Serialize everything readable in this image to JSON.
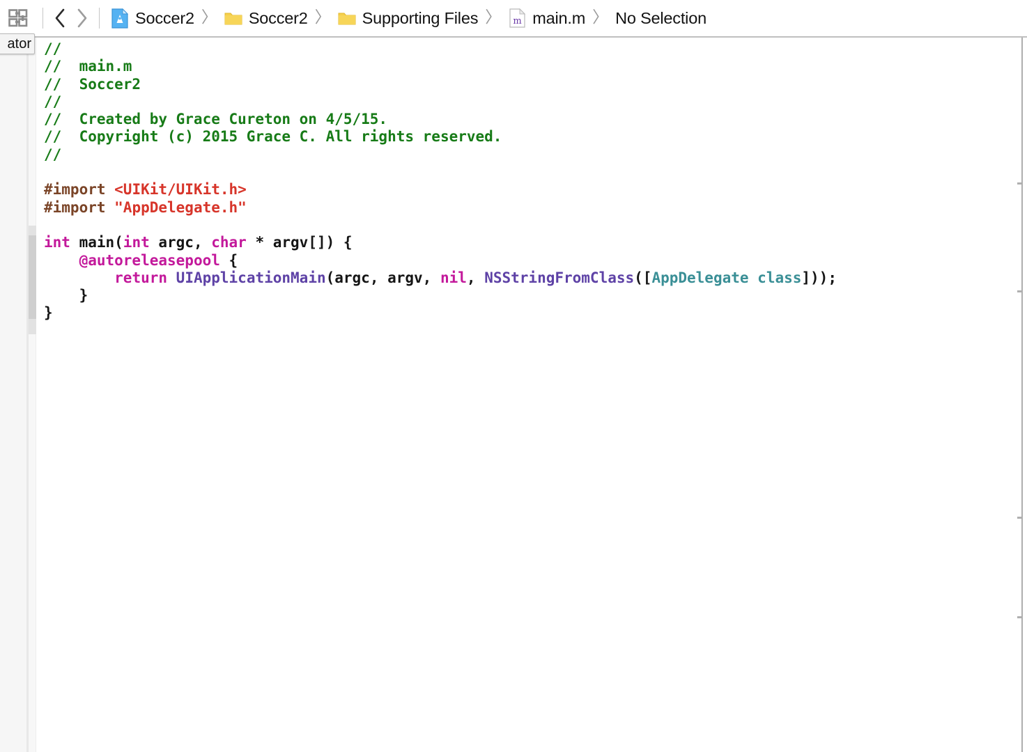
{
  "window": {
    "title": "main.m — Soccer2",
    "background": "#ffffff"
  },
  "jumpbar": {
    "navigator_toggle_icon": "navigator-grid-icon",
    "back_label": "‹",
    "forward_label": "›",
    "separator": "〉",
    "breadcrumbs": [
      {
        "label": "Soccer2",
        "icon": "xcode-project-icon"
      },
      {
        "label": "Soccer2",
        "icon": "folder-icon"
      },
      {
        "label": "Supporting Files",
        "icon": "folder-icon"
      },
      {
        "label": "main.m",
        "icon": "objc-file-icon"
      },
      {
        "label": "No Selection",
        "icon": "none"
      }
    ]
  },
  "tooltip": {
    "text": "ator"
  },
  "editor": {
    "file_name": "main.m",
    "language": "Objective-C",
    "colors": {
      "comment": "#177b17",
      "preprocessor": "#7a4427",
      "string": "#d7352a",
      "keyword": "#c3199b",
      "plain": "#151515",
      "function": "#5e42a6",
      "type": "#3a8f96",
      "background": "#ffffff",
      "gutter": "#f7f7f7"
    },
    "lines": [
      [
        {
          "t": "//",
          "c": "comment"
        }
      ],
      [
        {
          "t": "//  main.m",
          "c": "comment"
        }
      ],
      [
        {
          "t": "//  Soccer2",
          "c": "comment"
        }
      ],
      [
        {
          "t": "//",
          "c": "comment"
        }
      ],
      [
        {
          "t": "//  Created by Grace Cureton on 4/5/15.",
          "c": "comment"
        }
      ],
      [
        {
          "t": "//  Copyright (c) 2015 Grace C. All rights reserved.",
          "c": "comment"
        }
      ],
      [
        {
          "t": "//",
          "c": "comment"
        }
      ],
      [],
      [
        {
          "t": "#import ",
          "c": "preproc"
        },
        {
          "t": "<UIKit/UIKit.h>",
          "c": "string"
        }
      ],
      [
        {
          "t": "#import ",
          "c": "preproc"
        },
        {
          "t": "\"AppDelegate.h\"",
          "c": "string"
        }
      ],
      [],
      [
        {
          "t": "int",
          "c": "keyword"
        },
        {
          "t": " main(",
          "c": "plain"
        },
        {
          "t": "int",
          "c": "keyword"
        },
        {
          "t": " argc, ",
          "c": "plain"
        },
        {
          "t": "char",
          "c": "keyword"
        },
        {
          "t": " * argv[]) {",
          "c": "plain"
        }
      ],
      [
        {
          "t": "    ",
          "c": "plain"
        },
        {
          "t": "@autoreleasepool",
          "c": "keyword"
        },
        {
          "t": " {",
          "c": "plain"
        }
      ],
      [
        {
          "t": "        ",
          "c": "plain"
        },
        {
          "t": "return",
          "c": "keyword"
        },
        {
          "t": " ",
          "c": "plain"
        },
        {
          "t": "UIApplicationMain",
          "c": "func"
        },
        {
          "t": "(argc, argv, ",
          "c": "plain"
        },
        {
          "t": "nil",
          "c": "keyword"
        },
        {
          "t": ", ",
          "c": "plain"
        },
        {
          "t": "NSStringFromClass",
          "c": "func"
        },
        {
          "t": "([",
          "c": "plain"
        },
        {
          "t": "AppDelegate class",
          "c": "type"
        },
        {
          "t": "]));",
          "c": "plain"
        }
      ],
      [
        {
          "t": "    }",
          "c": "plain"
        }
      ],
      [
        {
          "t": "}",
          "c": "plain"
        }
      ]
    ]
  },
  "scroll": {
    "tick_positions": [
      262,
      417,
      742,
      885
    ]
  }
}
